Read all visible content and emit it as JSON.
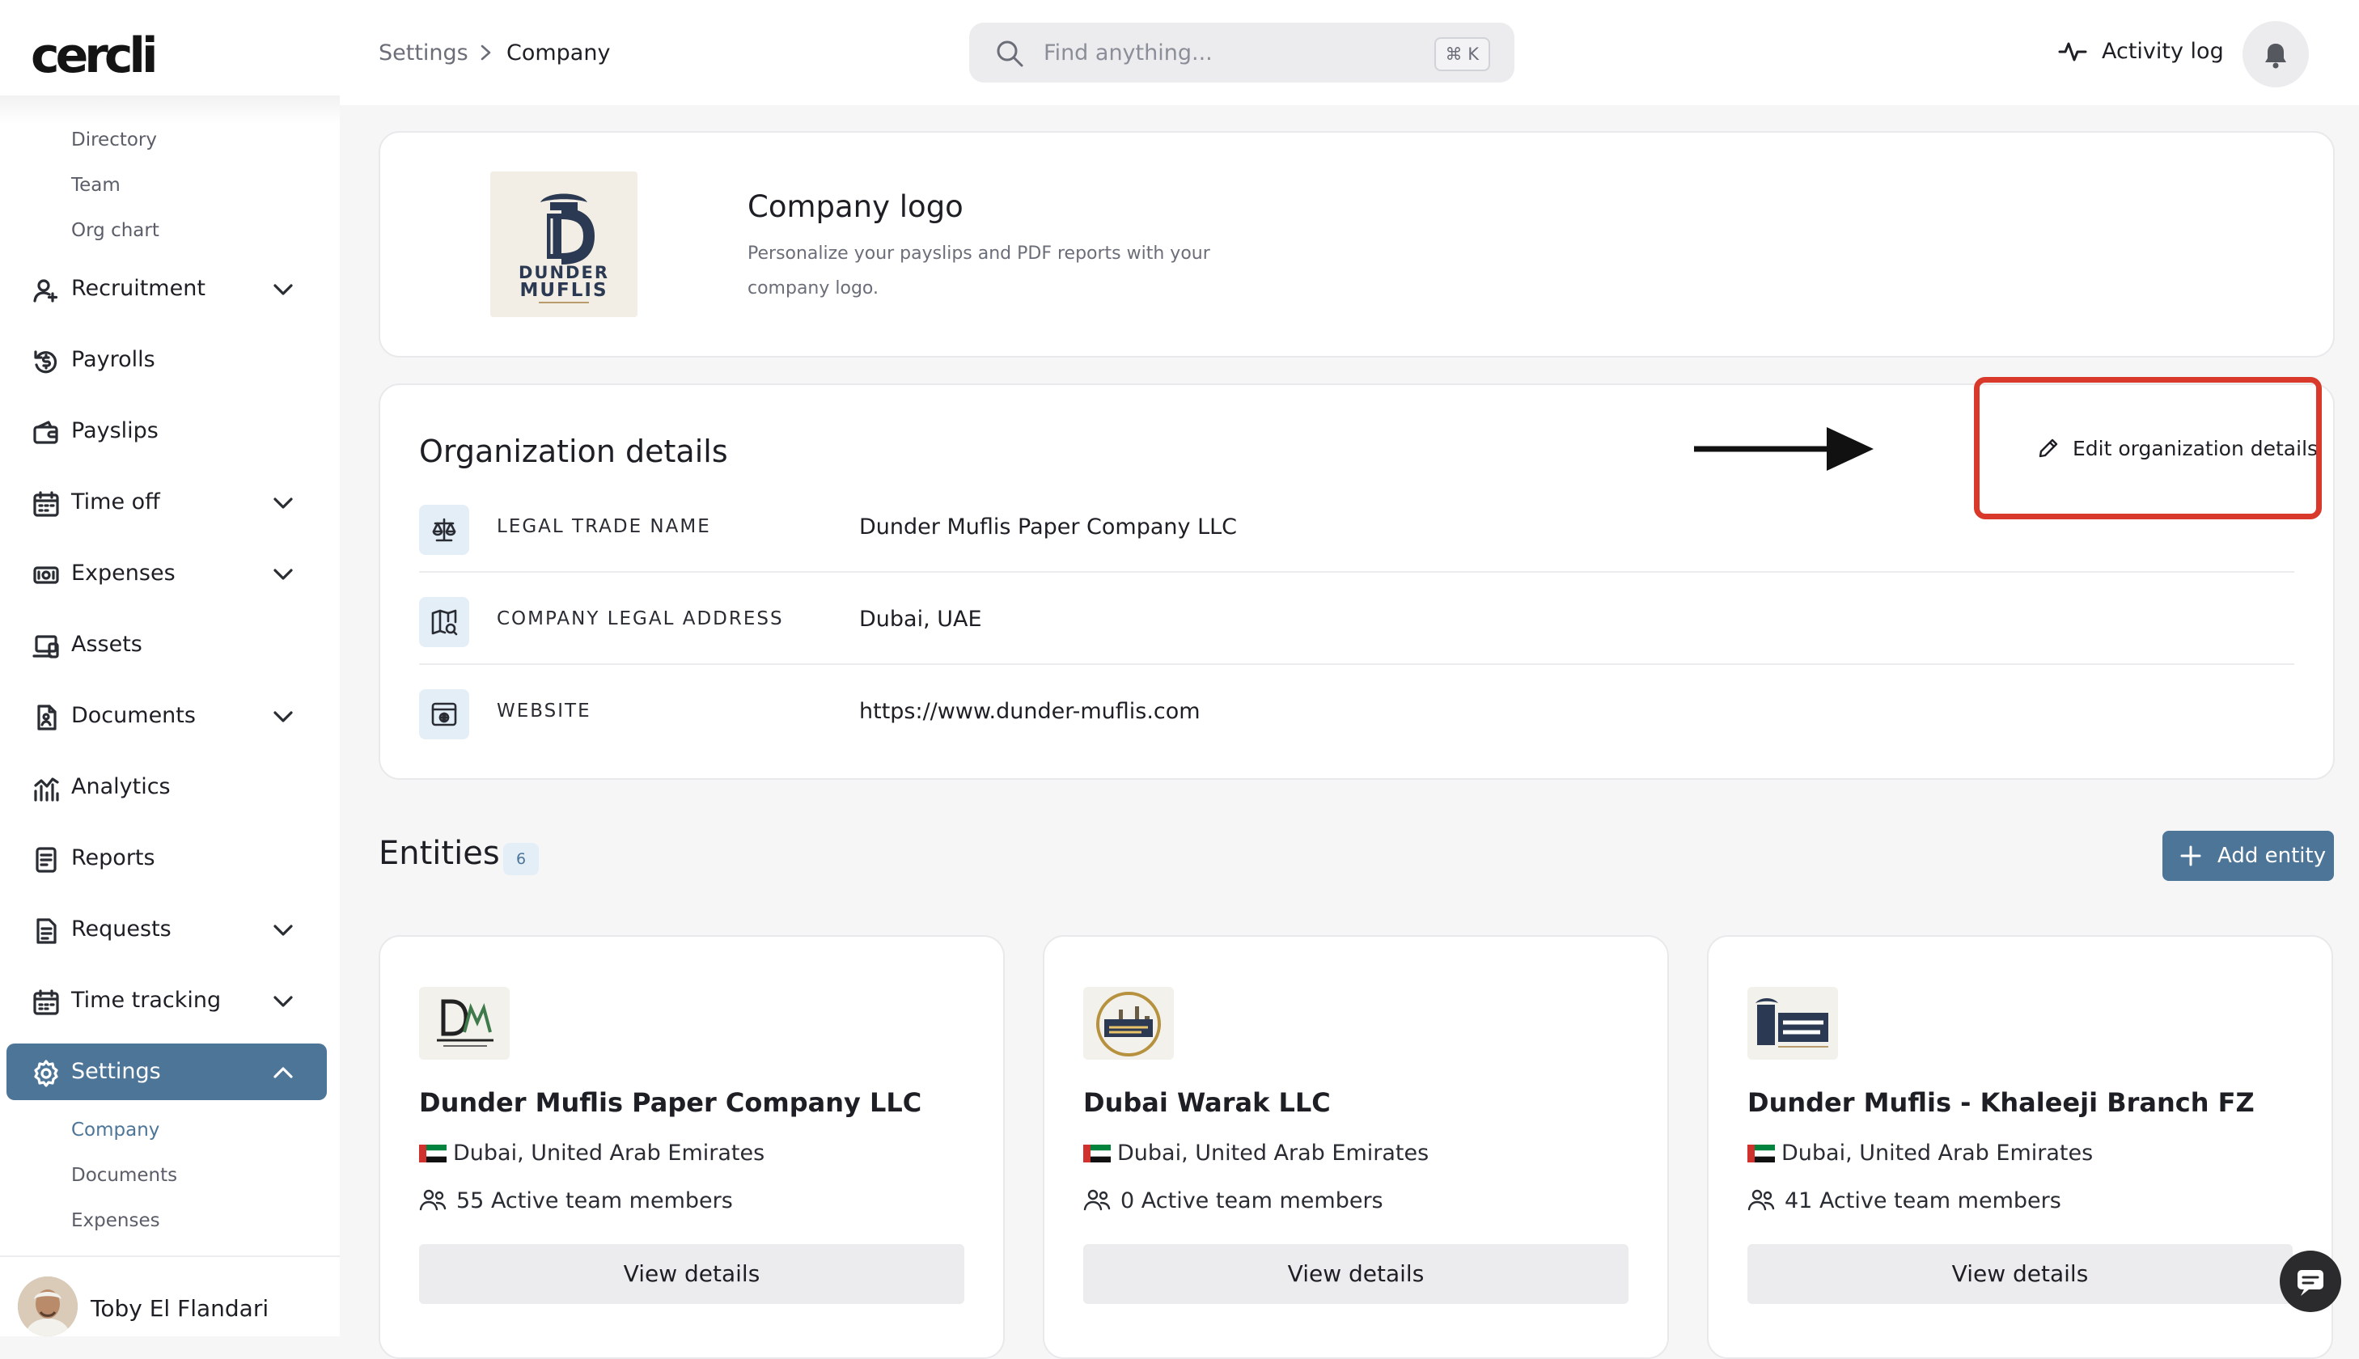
{
  "brand": "cercli",
  "sidebar": {
    "top_subitems": [
      "Directory",
      "Team",
      "Org chart"
    ],
    "items": [
      {
        "label": "Recruitment",
        "icon": "user-plus-icon",
        "expandable": true
      },
      {
        "label": "Payrolls",
        "icon": "payroll-icon",
        "expandable": false
      },
      {
        "label": "Payslips",
        "icon": "wallet-icon",
        "expandable": false
      },
      {
        "label": "Time off",
        "icon": "calendar-icon",
        "expandable": true
      },
      {
        "label": "Expenses",
        "icon": "money-icon",
        "expandable": true
      },
      {
        "label": "Assets",
        "icon": "laptop-icon",
        "expandable": false
      },
      {
        "label": "Documents",
        "icon": "document-icon",
        "expandable": true
      },
      {
        "label": "Analytics",
        "icon": "analytics-icon",
        "expandable": false
      },
      {
        "label": "Reports",
        "icon": "report-icon",
        "expandable": false
      },
      {
        "label": "Requests",
        "icon": "request-icon",
        "expandable": true
      },
      {
        "label": "Time tracking",
        "icon": "calendar-clock-icon",
        "expandable": true
      },
      {
        "label": "Settings",
        "icon": "gear-icon",
        "expandable": true,
        "active": true
      }
    ],
    "settings_subitems": [
      "Company",
      "Documents",
      "Expenses"
    ],
    "settings_current": "Company",
    "user": {
      "name": "Toby El Flandari"
    }
  },
  "topbar": {
    "breadcrumb": [
      "Settings",
      "Company"
    ],
    "search_placeholder": "Find anything...",
    "search_shortcut": "⌘ K",
    "activity_label": "Activity log"
  },
  "company_logo": {
    "title": "Company logo",
    "description": "Personalize your payslips and PDF reports with your company logo.",
    "logo_text": [
      "DUNDER",
      "MUFLIS"
    ]
  },
  "org": {
    "title": "Organization details",
    "edit_label": "Edit organization details",
    "rows": [
      {
        "key": "LEGAL TRADE NAME",
        "value": "Dunder Muflis Paper Company LLC",
        "icon": "scale-icon"
      },
      {
        "key": "COMPANY LEGAL ADDRESS",
        "value": "Dubai, UAE",
        "icon": "map-icon"
      },
      {
        "key": "WEBSITE",
        "value": "https://www.dunder-muflis.com",
        "icon": "browser-icon"
      }
    ]
  },
  "entities": {
    "title": "Entities",
    "count": "6",
    "add_label": "Add entity",
    "items": [
      {
        "name": "Dunder Muflis Paper Company LLC",
        "location": "Dubai, United Arab Emirates",
        "members": "55 Active team members",
        "button": "View details"
      },
      {
        "name": "Dubai Warak LLC",
        "location": "Dubai, United Arab Emirates",
        "members": "0 Active team members",
        "button": "View details"
      },
      {
        "name": "Dunder Muflis - Khaleeji Branch FZ",
        "location": "Dubai, United Arab Emirates",
        "members": "41 Active team members",
        "button": "View details"
      }
    ]
  },
  "colors": {
    "accent": "#4d7598",
    "highlight": "#d9392b",
    "background": "#f6f6f7"
  }
}
